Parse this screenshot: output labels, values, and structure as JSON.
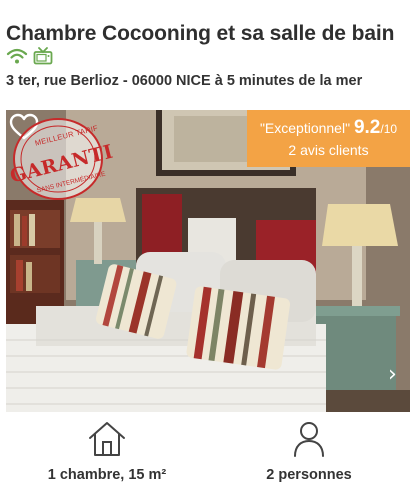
{
  "listing": {
    "title": "Chambre Cocooning et sa salle de bain",
    "address": "3 ter, rue Berlioz - 06000 NICE à 5 minutes de la mer",
    "amenities": [
      {
        "icon": "wifi-icon"
      },
      {
        "icon": "tv-icon"
      }
    ]
  },
  "photo": {
    "stamp": {
      "top_text": "MEILLEUR TARIF",
      "main_text": "GARANTI",
      "bottom_text": "SANS INTERMÉDIAIRE"
    },
    "rating": {
      "label": "\"Exceptionnel\"",
      "score": "9.2",
      "max": "/10",
      "reviews": "2 avis clients"
    },
    "next_glyph": "›"
  },
  "features": [
    {
      "icon": "house-icon",
      "label": "1 chambre, 15 m²"
    },
    {
      "icon": "person-icon",
      "label": "2 personnes"
    }
  ],
  "colors": {
    "brand_green": "#6aa84f",
    "rating_orange": "#f3a345",
    "stamp_red": "#c62a2a"
  }
}
